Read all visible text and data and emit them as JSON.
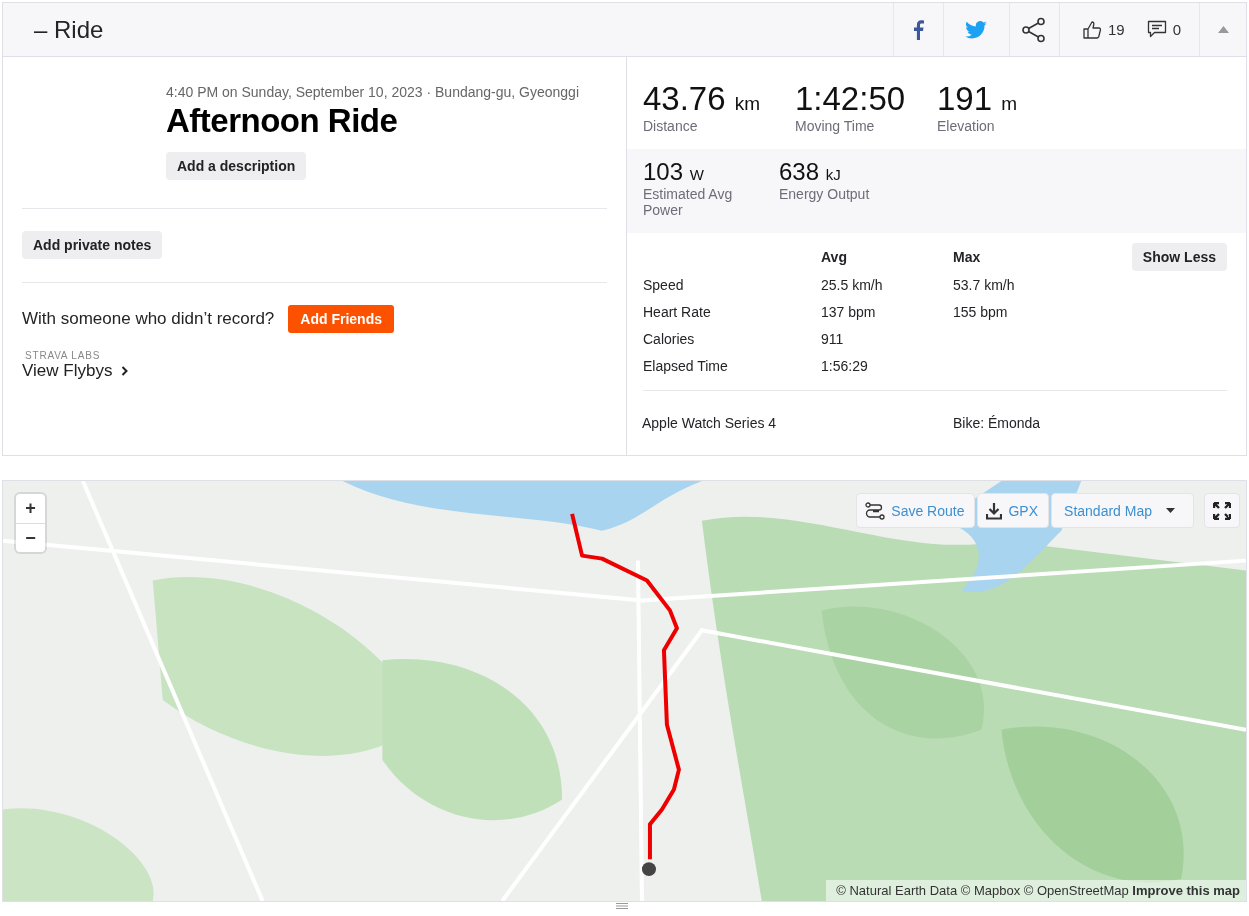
{
  "header": {
    "title": "– Ride",
    "kudos_count": "19",
    "comment_count": "0"
  },
  "activity": {
    "datetime_location": "4:40 PM on Sunday, September 10, 2023 · Bundang-gu, Gyeonggi",
    "name": "Afternoon Ride",
    "description_button": "Add a description",
    "private_notes_button": "Add private notes",
    "friends_prompt": "With someone who didn’t record?",
    "add_friends_button": "Add Friends",
    "labs_label": "STRAVA LABS",
    "flybys_link": "View Flybys"
  },
  "primary_stats": [
    {
      "value": "43.76",
      "unit": "km",
      "label": "Distance"
    },
    {
      "value": "1:42:50",
      "label": "Moving Time"
    },
    {
      "value": "191",
      "unit": "m",
      "label": "Elevation"
    }
  ],
  "secondary_stats": [
    {
      "value": "103",
      "unit": "W",
      "label": "Estimated Avg Power"
    },
    {
      "value": "638",
      "unit": "kJ",
      "label": "Energy Output"
    }
  ],
  "details": {
    "columns": [
      "Avg",
      "Max"
    ],
    "show_less_button": "Show Less",
    "rows": [
      {
        "label": "Speed",
        "avg": "25.5 km/h",
        "max": "53.7 km/h"
      },
      {
        "label": "Heart Rate",
        "avg": "137 bpm",
        "max": "155 bpm"
      },
      {
        "label": "Calories",
        "avg": "911"
      },
      {
        "label": "Elapsed Time",
        "avg": "1:56:29"
      }
    ],
    "device": "Apple Watch Series 4",
    "bike": "Bike: Émonda"
  },
  "map": {
    "zoom_in": "+",
    "zoom_out": "−",
    "save_route": "Save Route",
    "gpx": "GPX",
    "map_style": "Standard Map",
    "attribution": "© Natural Earth Data © Mapbox © OpenStreetMap",
    "attribution_link": "Improve this map"
  }
}
